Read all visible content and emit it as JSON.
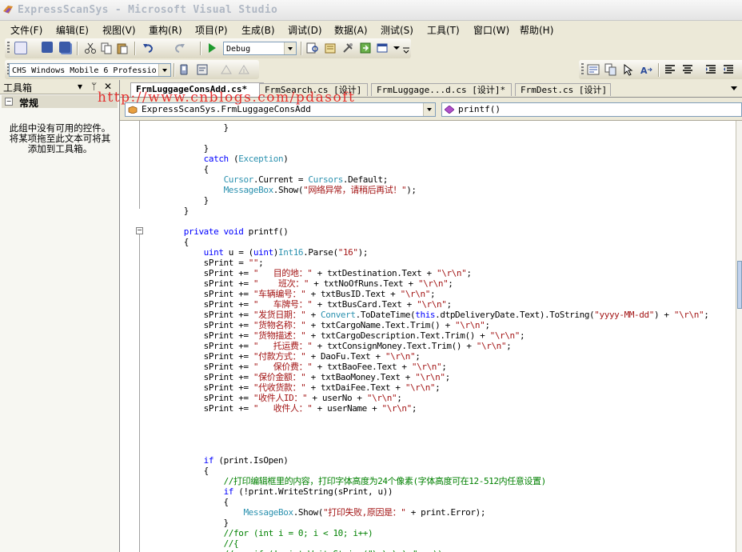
{
  "window": {
    "title": "ExpressScanSys - Microsoft Visual Studio"
  },
  "menu": [
    "文件(F)",
    "编辑(E)",
    "视图(V)",
    "重构(R)",
    "项目(P)",
    "生成(B)",
    "调试(D)",
    "数据(A)",
    "测试(S)",
    "工具(T)",
    "窗口(W)",
    "帮助(H)"
  ],
  "toolbar": {
    "config": "Debug",
    "platform": "CHS Windows Mobile 6 Professio"
  },
  "toolbox": {
    "title": "工具箱",
    "pin": "ᛘ",
    "close": "✕",
    "dropdown": "▾",
    "group_toggle": "−",
    "group": "常规",
    "empty_message": "此组中没有可用的控件。将某项拖至此文本可将其添加到工具箱。"
  },
  "tabs": [
    {
      "label": "FrmLuggageConsAdd.cs*"
    },
    {
      "label": "FrmSearch.cs [设计]"
    },
    {
      "label": "FrmLuggage...d.cs [设计]*"
    },
    {
      "label": "FrmDest.cs [设计]"
    }
  ],
  "nav": {
    "class_selector": "ExpressScanSys.FrmLuggageConsAdd",
    "member_selector": "printf()"
  },
  "watermark": "http://www.cnblogs.com/pdasoft",
  "code": [
    [
      {
        "t": "                }"
      }
    ],
    [
      {
        "t": ""
      }
    ],
    [
      {
        "t": "            }"
      }
    ],
    [
      {
        "t": "            "
      },
      {
        "t": "catch",
        "c": "kw"
      },
      {
        "t": " ("
      },
      {
        "t": "Exception",
        "c": "ty"
      },
      {
        "t": ")"
      }
    ],
    [
      {
        "t": "            {"
      }
    ],
    [
      {
        "t": "                "
      },
      {
        "t": "Cursor",
        "c": "ty"
      },
      {
        "t": ".Current = "
      },
      {
        "t": "Cursors",
        "c": "ty"
      },
      {
        "t": ".Default;"
      }
    ],
    [
      {
        "t": "                "
      },
      {
        "t": "MessageBox",
        "c": "ty"
      },
      {
        "t": ".Show("
      },
      {
        "t": "\"网络异常，请稍后再试！\"",
        "c": "st"
      },
      {
        "t": ");"
      }
    ],
    [
      {
        "t": "            }"
      }
    ],
    [
      {
        "t": "        }"
      }
    ],
    [
      {
        "t": ""
      }
    ],
    [
      {
        "t": "        "
      },
      {
        "t": "private void",
        "c": "kw"
      },
      {
        "t": " printf()"
      }
    ],
    [
      {
        "t": "        {"
      }
    ],
    [
      {
        "t": "            "
      },
      {
        "t": "uint",
        "c": "kw"
      },
      {
        "t": " u = ("
      },
      {
        "t": "uint",
        "c": "kw"
      },
      {
        "t": ")"
      },
      {
        "t": "Int16",
        "c": "ty"
      },
      {
        "t": ".Parse("
      },
      {
        "t": "\"16\"",
        "c": "st"
      },
      {
        "t": ");"
      }
    ],
    [
      {
        "t": "            sPrint = "
      },
      {
        "t": "\"\"",
        "c": "st"
      },
      {
        "t": ";"
      }
    ],
    [
      {
        "t": "            sPrint += "
      },
      {
        "t": "\"   目的地：\"",
        "c": "st"
      },
      {
        "t": " + txtDestination.Text + "
      },
      {
        "t": "\"\\r\\n\"",
        "c": "st"
      },
      {
        "t": ";"
      }
    ],
    [
      {
        "t": "            sPrint += "
      },
      {
        "t": "\"    班次：\"",
        "c": "st"
      },
      {
        "t": " + txtNoOfRuns.Text + "
      },
      {
        "t": "\"\\r\\n\"",
        "c": "st"
      },
      {
        "t": ";"
      }
    ],
    [
      {
        "t": "            sPrint += "
      },
      {
        "t": "\"车辆编号：\"",
        "c": "st"
      },
      {
        "t": " + txtBusID.Text + "
      },
      {
        "t": "\"\\r\\n\"",
        "c": "st"
      },
      {
        "t": ";"
      }
    ],
    [
      {
        "t": "            sPrint += "
      },
      {
        "t": "\"   车牌号：\"",
        "c": "st"
      },
      {
        "t": " + txtBusCard.Text + "
      },
      {
        "t": "\"\\r\\n\"",
        "c": "st"
      },
      {
        "t": ";"
      }
    ],
    [
      {
        "t": "            sPrint += "
      },
      {
        "t": "\"发货日期：\"",
        "c": "st"
      },
      {
        "t": " + "
      },
      {
        "t": "Convert",
        "c": "ty"
      },
      {
        "t": ".ToDateTime("
      },
      {
        "t": "this",
        "c": "kw"
      },
      {
        "t": ".dtpDeliveryDate.Text).ToString("
      },
      {
        "t": "\"yyyy-MM-dd\"",
        "c": "st"
      },
      {
        "t": ") + "
      },
      {
        "t": "\"\\r\\n\"",
        "c": "st"
      },
      {
        "t": ";"
      }
    ],
    [
      {
        "t": "            sPrint += "
      },
      {
        "t": "\"货物名称：\"",
        "c": "st"
      },
      {
        "t": " + txtCargoName.Text.Trim() + "
      },
      {
        "t": "\"\\r\\n\"",
        "c": "st"
      },
      {
        "t": ";"
      }
    ],
    [
      {
        "t": "            sPrint += "
      },
      {
        "t": "\"货物描述：\"",
        "c": "st"
      },
      {
        "t": " + txtCargoDescription.Text.Trim() + "
      },
      {
        "t": "\"\\r\\n\"",
        "c": "st"
      },
      {
        "t": ";"
      }
    ],
    [
      {
        "t": "            sPrint += "
      },
      {
        "t": "\"   托运费：\"",
        "c": "st"
      },
      {
        "t": " + txtConsignMoney.Text.Trim() + "
      },
      {
        "t": "\"\\r\\n\"",
        "c": "st"
      },
      {
        "t": ";"
      }
    ],
    [
      {
        "t": "            sPrint += "
      },
      {
        "t": "\"付款方式：\"",
        "c": "st"
      },
      {
        "t": " + DaoFu.Text + "
      },
      {
        "t": "\"\\r\\n\"",
        "c": "st"
      },
      {
        "t": ";"
      }
    ],
    [
      {
        "t": "            sPrint += "
      },
      {
        "t": "\"   保价费：\"",
        "c": "st"
      },
      {
        "t": " + txtBaoFee.Text + "
      },
      {
        "t": "\"\\r\\n\"",
        "c": "st"
      },
      {
        "t": ";"
      }
    ],
    [
      {
        "t": "            sPrint += "
      },
      {
        "t": "\"保价金额：\"",
        "c": "st"
      },
      {
        "t": " + txtBaoMoney.Text + "
      },
      {
        "t": "\"\\r\\n\"",
        "c": "st"
      },
      {
        "t": ";"
      }
    ],
    [
      {
        "t": "            sPrint += "
      },
      {
        "t": "\"代收货款：\"",
        "c": "st"
      },
      {
        "t": " + txtDaiFee.Text + "
      },
      {
        "t": "\"\\r\\n\"",
        "c": "st"
      },
      {
        "t": ";"
      }
    ],
    [
      {
        "t": "            sPrint += "
      },
      {
        "t": "\"收件人ID：\"",
        "c": "st"
      },
      {
        "t": " + userNo + "
      },
      {
        "t": "\"\\r\\n\"",
        "c": "st"
      },
      {
        "t": ";"
      }
    ],
    [
      {
        "t": "            sPrint += "
      },
      {
        "t": "\"   收件人：\"",
        "c": "st"
      },
      {
        "t": " + userName + "
      },
      {
        "t": "\"\\r\\n\"",
        "c": "st"
      },
      {
        "t": ";"
      }
    ],
    [
      {
        "t": ""
      }
    ],
    [
      {
        "t": ""
      }
    ],
    [
      {
        "t": ""
      }
    ],
    [
      {
        "t": ""
      }
    ],
    [
      {
        "t": "            "
      },
      {
        "t": "if",
        "c": "kw"
      },
      {
        "t": " (print.IsOpen)"
      }
    ],
    [
      {
        "t": "            {"
      }
    ],
    [
      {
        "t": "                "
      },
      {
        "t": "//打印编辑框里的内容，打印字体高度为24个像素(字体高度可在12-512内任意设置)",
        "c": "cm"
      }
    ],
    [
      {
        "t": "                "
      },
      {
        "t": "if",
        "c": "kw"
      },
      {
        "t": " (!print.WriteString(sPrint, u))"
      }
    ],
    [
      {
        "t": "                {"
      }
    ],
    [
      {
        "t": "                    "
      },
      {
        "t": "MessageBox",
        "c": "ty"
      },
      {
        "t": ".Show("
      },
      {
        "t": "\"打印失败,原因是：\"",
        "c": "st"
      },
      {
        "t": " + print.Error);"
      }
    ],
    [
      {
        "t": "                }"
      }
    ],
    [
      {
        "t": "                "
      },
      {
        "t": "//for (int i = 0; i < 10; i++)",
        "c": "cm"
      }
    ],
    [
      {
        "t": "                "
      },
      {
        "t": "//{",
        "c": "cm"
      }
    ],
    [
      {
        "t": "                "
      },
      {
        "t": "//    if (!print.WriteString(\"\\r\\n\\r\\n\", u))",
        "c": "cm"
      }
    ],
    [
      {
        "t": "                "
      },
      {
        "t": "//    {",
        "c": "cm"
      }
    ]
  ]
}
